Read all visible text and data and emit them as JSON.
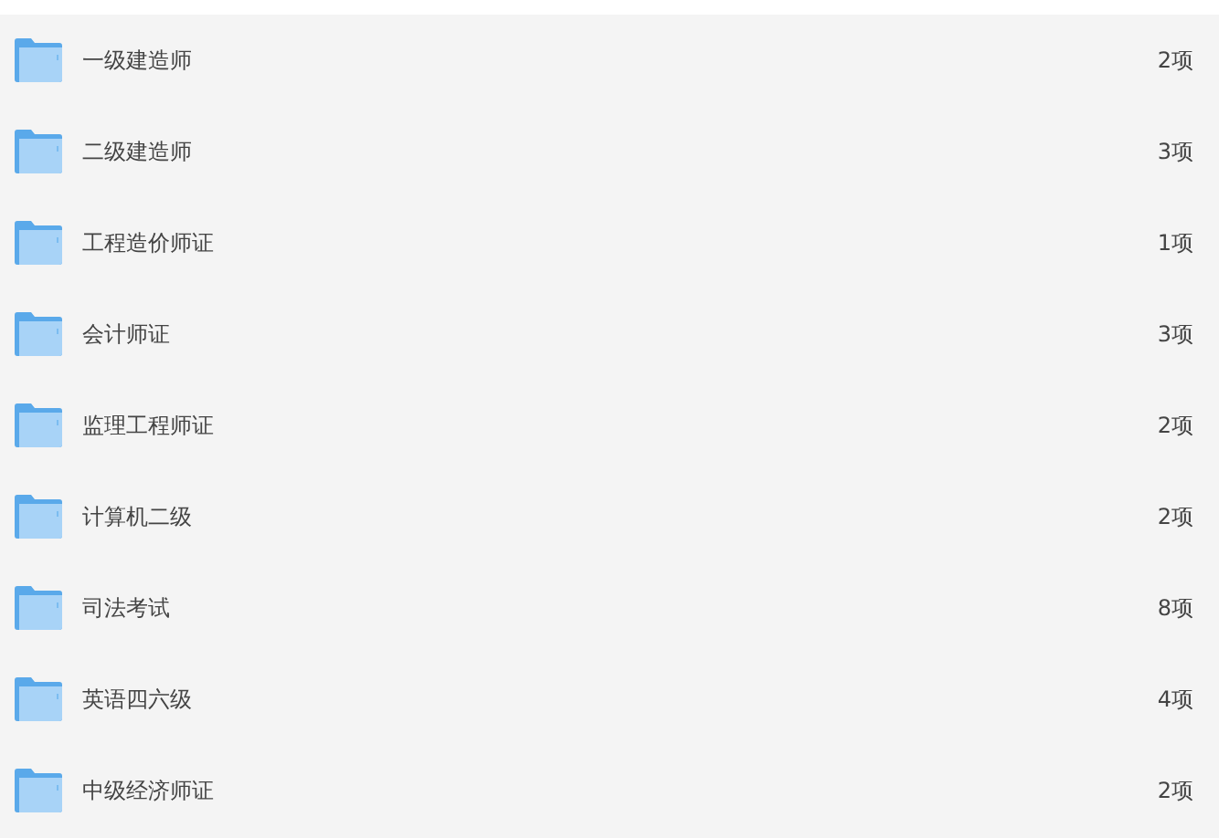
{
  "folders": [
    {
      "name": "一级建造师",
      "count": "2项"
    },
    {
      "name": "二级建造师",
      "count": "3项"
    },
    {
      "name": "工程造价师证",
      "count": "1项"
    },
    {
      "name": "会计师证",
      "count": "3项"
    },
    {
      "name": "监理工程师证",
      "count": "2项"
    },
    {
      "name": "计算机二级",
      "count": "2项"
    },
    {
      "name": "司法考试",
      "count": "8项"
    },
    {
      "name": "英语四六级",
      "count": "4项"
    },
    {
      "name": "中级经济师证",
      "count": "2项"
    }
  ]
}
